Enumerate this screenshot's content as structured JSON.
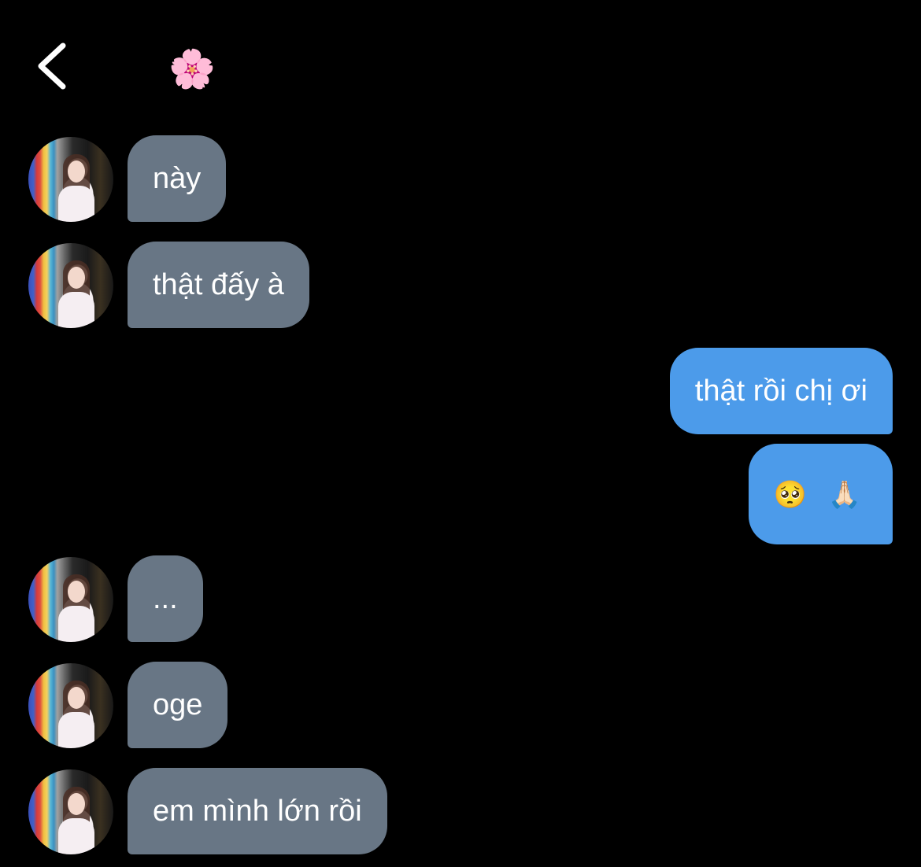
{
  "header": {
    "back_icon": "chevron-left-icon",
    "title_emoji": "🌸"
  },
  "colors": {
    "background": "#000000",
    "incoming_bubble": "#687685",
    "outgoing_bubble": "#4c9bea",
    "text": "#ffffff"
  },
  "messages": [
    {
      "direction": "incoming",
      "text": "này"
    },
    {
      "direction": "incoming",
      "text": "thật đấy à"
    },
    {
      "direction": "outgoing",
      "text": "thật rồi chị ơi"
    },
    {
      "direction": "outgoing",
      "text": "🥺 🙏🏻"
    },
    {
      "direction": "incoming",
      "text": "..."
    },
    {
      "direction": "incoming",
      "text": "oge"
    },
    {
      "direction": "incoming",
      "text": "em mình lớn rồi"
    }
  ]
}
